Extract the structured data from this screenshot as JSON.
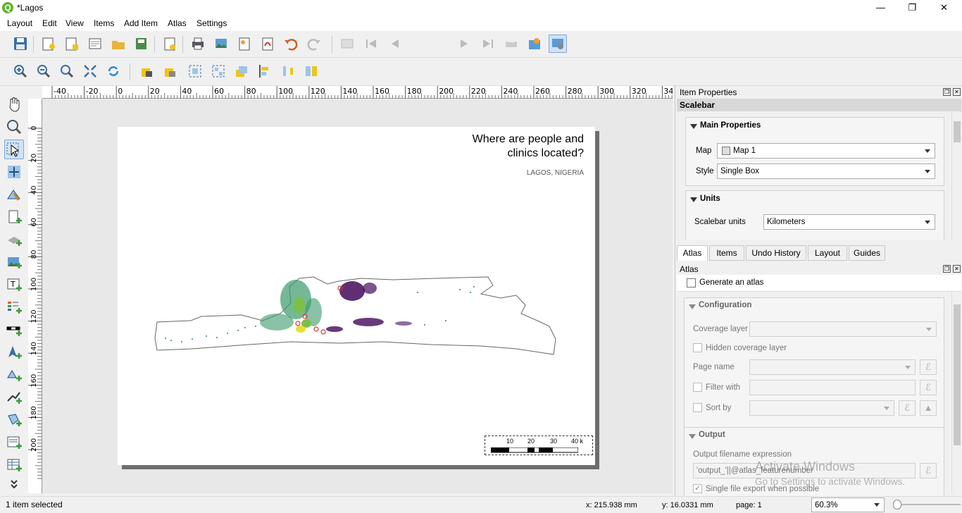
{
  "window": {
    "title": "*Lagos",
    "minimize": "—",
    "restore": "❐",
    "close": "✕"
  },
  "menu": [
    "Layout",
    "Edit",
    "View",
    "Items",
    "Add Item",
    "Atlas",
    "Settings"
  ],
  "toolbar": {
    "page_number": "1"
  },
  "rulers": {
    "h_ticks": [
      "-40",
      "-20",
      "0",
      "20",
      "40",
      "60",
      "80",
      "100",
      "120",
      "140",
      "160",
      "180",
      "200",
      "220",
      "240",
      "260",
      "280",
      "300",
      "320",
      "34"
    ],
    "v_ticks": [
      "0",
      "20",
      "40",
      "60",
      "80",
      "100",
      "120",
      "140",
      "160",
      "180",
      "200"
    ]
  },
  "layout_page": {
    "title": "Where are people and\nclinics located?",
    "subtitle": "LAGOS, NIGERIA",
    "scalebar_labels": [
      "10",
      "20",
      "30",
      "40 k"
    ]
  },
  "item_properties": {
    "panel_title": "Item Properties",
    "item_type": "Scalebar",
    "main_properties": {
      "heading": "Main Properties",
      "map_label": "Map",
      "map_value": "Map 1",
      "style_label": "Style",
      "style_value": "Single Box"
    },
    "units": {
      "heading": "Units",
      "scalebar_units_label": "Scalebar units",
      "scalebar_units_value": "Kilometers"
    }
  },
  "tabs": [
    "Atlas",
    "Items",
    "Undo History",
    "Layout",
    "Guides"
  ],
  "atlas": {
    "panel_title": "Atlas",
    "generate_label": "Generate an atlas",
    "configuration_heading": "Configuration",
    "coverage_layer_label": "Coverage layer",
    "hidden_coverage_label": "Hidden coverage layer",
    "page_name_label": "Page name",
    "filter_with_label": "Filter with",
    "sort_by_label": "Sort by",
    "output_heading": "Output",
    "output_expr_label": "Output filename expression",
    "output_expr_value": "'output_'||@atlas_featurenumber",
    "single_file_label": "Single file export when possible"
  },
  "watermark": {
    "line1": "Activate Windows",
    "line2": "Go to Settings to activate Windows."
  },
  "status": {
    "selection": "1 item selected",
    "x": "x: 215.938 mm",
    "y": "y: 16.0331 mm",
    "page": "page: 1",
    "zoom": "60.3%"
  }
}
